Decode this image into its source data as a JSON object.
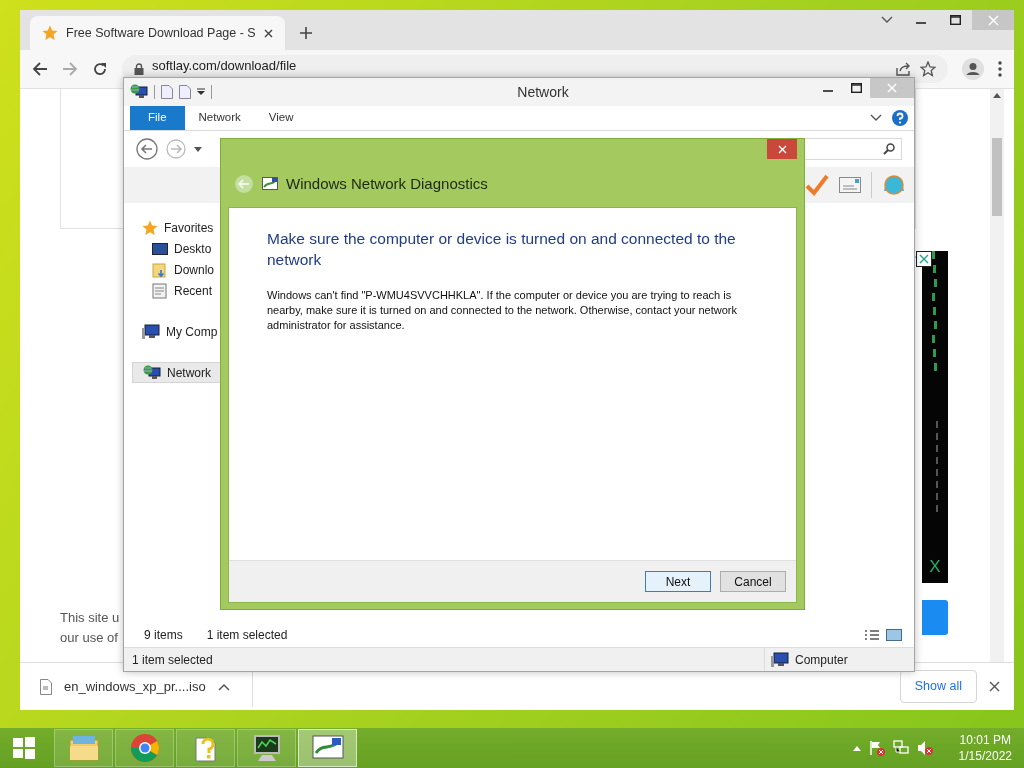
{
  "browser": {
    "tab": {
      "title": "Free Software Download Page - S"
    },
    "address": "softlay.com/download/file",
    "page": {
      "notice_lines": [
        "This site u",
        "our use of"
      ],
      "ad_label": "X"
    },
    "download": {
      "file": "en_windows_xp_pr....iso",
      "show_all": "Show all"
    }
  },
  "explorer": {
    "title": "Network",
    "ribbon_tabs": [
      {
        "label": "File",
        "selected": true
      },
      {
        "label": "Network",
        "selected": false
      },
      {
        "label": "View",
        "selected": false
      }
    ],
    "nav": [
      {
        "label": "Favorites",
        "kind": "favorites",
        "selected": false,
        "children": [
          {
            "label": "Deskto",
            "kind": "desktop",
            "selected": false
          },
          {
            "label": "Downlo",
            "kind": "downloads",
            "selected": false
          },
          {
            "label": "Recent",
            "kind": "recent",
            "selected": false
          }
        ]
      },
      {
        "label": "My Comp",
        "kind": "computer",
        "selected": false
      },
      {
        "label": "Network",
        "kind": "network",
        "selected": true
      }
    ],
    "items_count": "9 items",
    "selection": "1 item selected",
    "status_bar": {
      "left": "1 item selected",
      "right": "Computer"
    }
  },
  "dialog": {
    "title": "Windows Network Diagnostics",
    "heading": "Make sure the computer or device is turned on and connected to the network",
    "message": "Windows can't find \"P-WMU4SVVCHHKLA\". If the computer or device you are trying to reach is nearby, make sure it is turned on and connected to the network. Otherwise, contact your network administrator for assistance.",
    "buttons": [
      {
        "label": "Next",
        "default": true
      },
      {
        "label": "Cancel",
        "default": false
      }
    ]
  },
  "taskbar": {
    "apps": [
      {
        "kind": "explorer",
        "selected": false
      },
      {
        "kind": "chrome",
        "selected": false
      },
      {
        "kind": "help",
        "selected": false
      },
      {
        "kind": "monitor",
        "selected": false
      },
      {
        "kind": "diagnostics",
        "selected": true
      }
    ],
    "clock": {
      "time": "10:01 PM",
      "date": "1/15/2022"
    }
  }
}
